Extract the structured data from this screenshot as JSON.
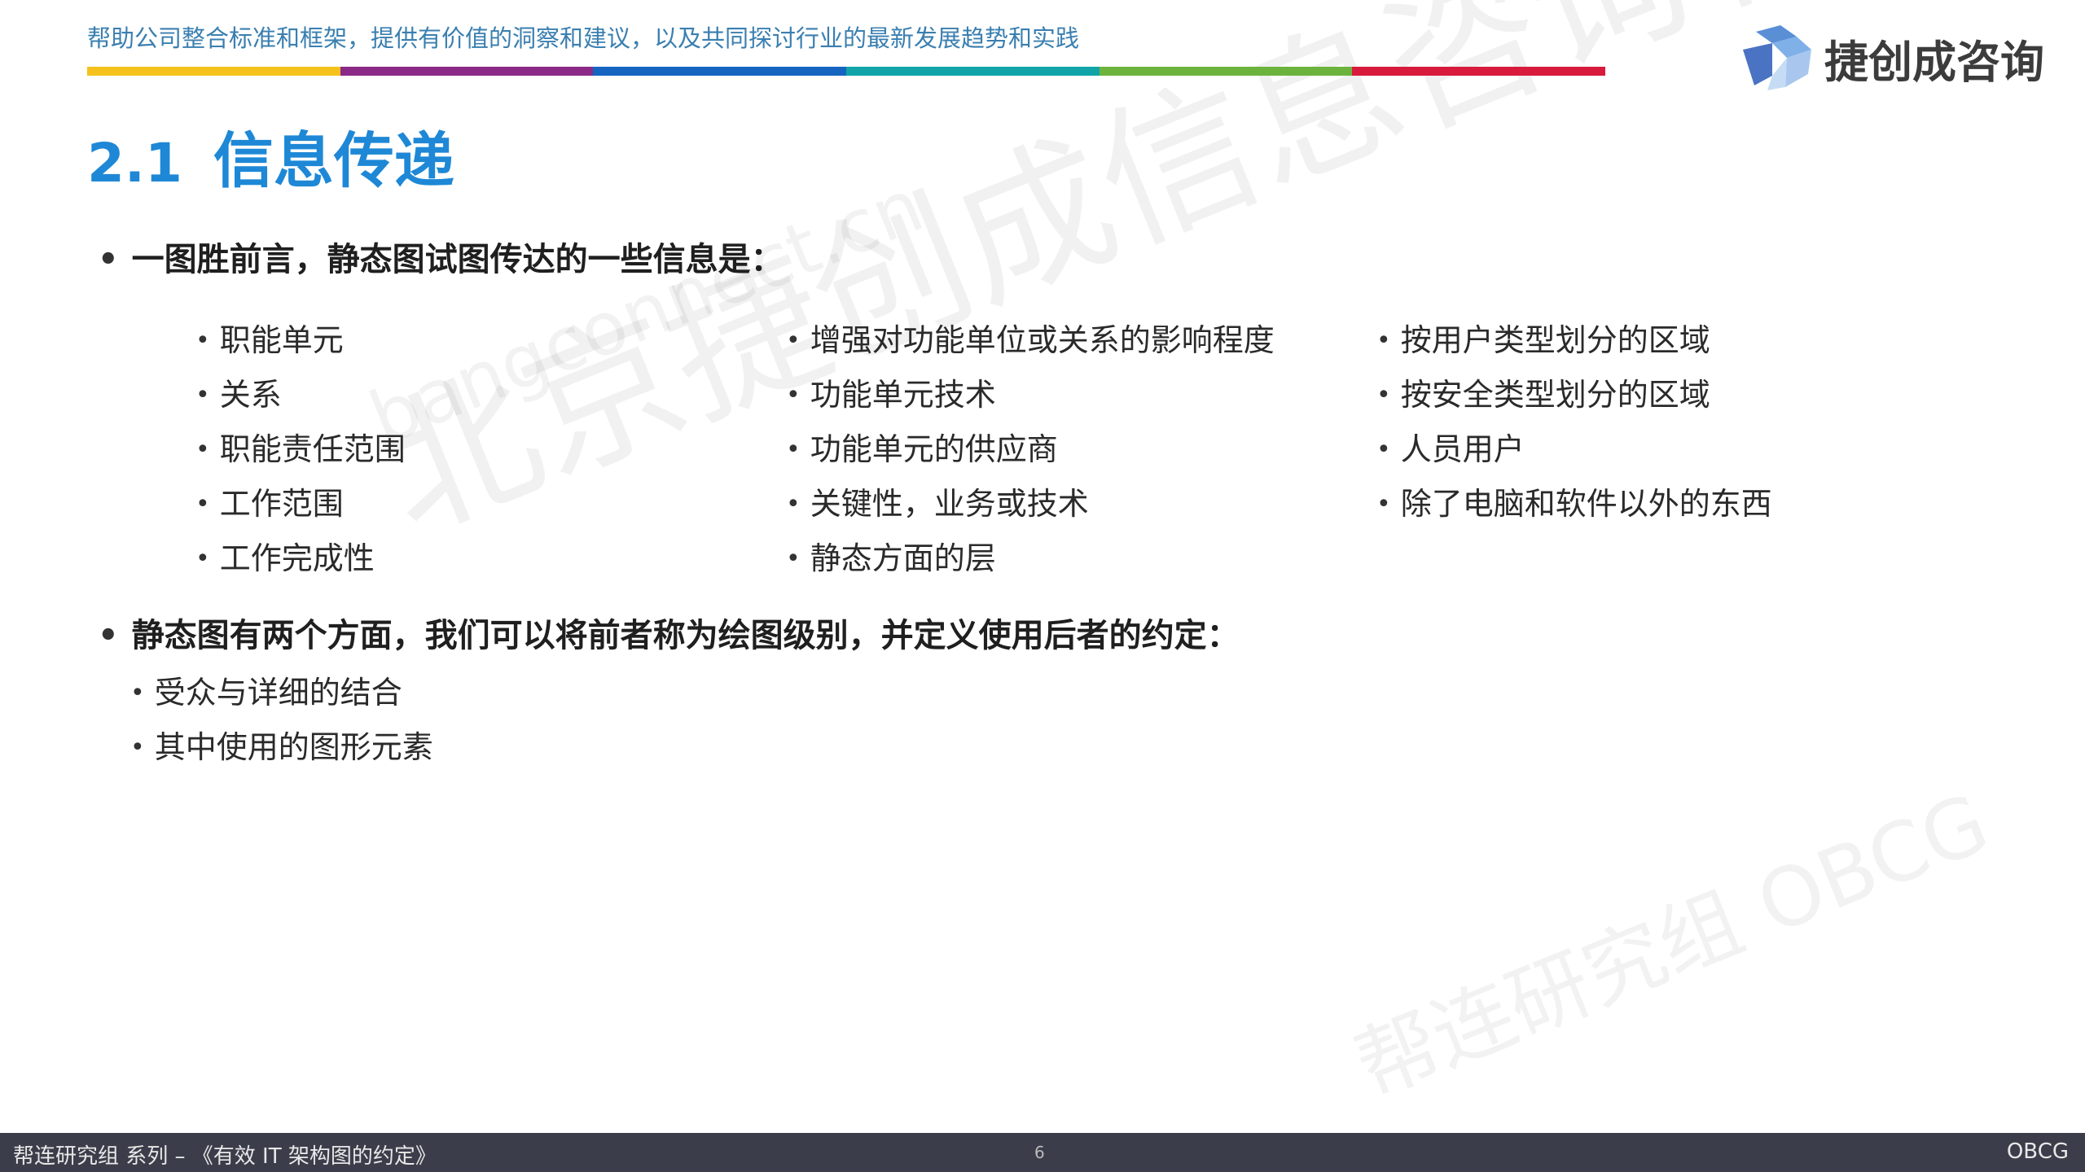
{
  "header": {
    "tagline": "帮助公司整合标准和框架，提供有价值的洞察和建议，以及共同探讨行业的最新发展趋势和实践",
    "color_bar": [
      "#f4c21b",
      "#8a2a86",
      "#1565c0",
      "#10a4a8",
      "#6cb33e",
      "#d81b3c"
    ],
    "logo_text": "捷创成咨询"
  },
  "title": {
    "number": "2.1",
    "text": "信息传递"
  },
  "bullets": {
    "first": "一图胜前言，静态图试图传达的一些信息是：",
    "columns": [
      [
        "职能单元",
        "关系",
        "职能责任范围",
        "工作范围",
        "工作完成性"
      ],
      [
        "增强对功能单位或关系的影响程度",
        "功能单元技术",
        "功能单元的供应商",
        "关键性，业务或技术",
        "静态方面的层"
      ],
      [
        "按用户类型划分的区域",
        "按安全类型划分的区域",
        "人员用户",
        "除了电脑和软件以外的东西"
      ]
    ],
    "second": "静态图有两个方面，我们可以将前者称为绘图级别，并定义使用后者的约定：",
    "second_items": [
      "受众与详细的结合",
      "其中使用的图形元素"
    ]
  },
  "watermarks": {
    "main": "北京捷创成信息咨询有限公司",
    "url": "bangconnect.cn",
    "group": "帮连研究组 OBCG"
  },
  "footer": {
    "left": "帮连研究组 系列 – 《有效 IT 架构图的约定》",
    "page": "6",
    "right": "OBCG"
  }
}
